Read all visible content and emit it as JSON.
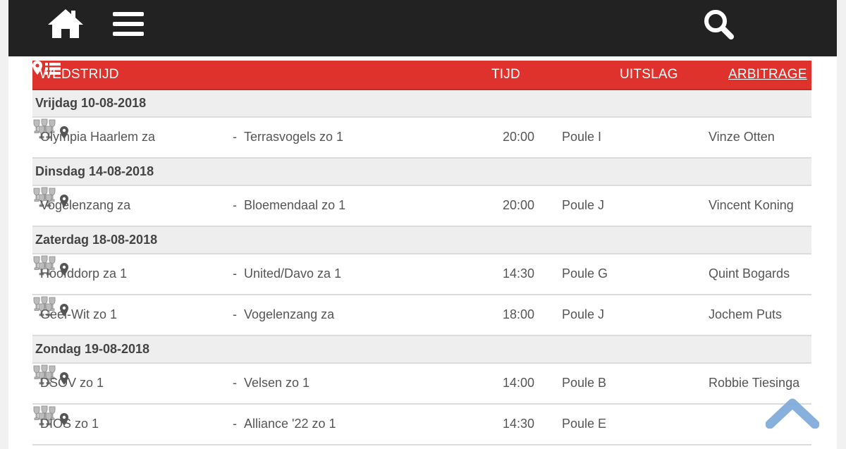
{
  "header": {
    "home_icon": "home-icon",
    "menu_icon": "hamburger-menu-icon",
    "search_icon": "search-icon",
    "background": "#222222"
  },
  "table": {
    "accent": "#e0322c",
    "columns": {
      "wedstrijd": "WEDSTRIJD",
      "tijd": "TIJD",
      "uitslag": "UITSLAG",
      "arbitrage": "ARBITRAGE"
    },
    "days": [
      {
        "date": "Vrijdag 10-08-2018",
        "matches": [
          {
            "home": "Olympia Haarlem za",
            "dash": "-",
            "away": "Terrasvogels zo 1",
            "time": "20:00",
            "poule": "Poule I",
            "referee": "Vinze  Otten"
          }
        ]
      },
      {
        "date": "Dinsdag 14-08-2018",
        "matches": [
          {
            "home": "Vogelenzang za",
            "dash": "-",
            "away": "Bloemendaal zo 1",
            "time": "20:00",
            "poule": "Poule J",
            "referee": "Vincent  Koning"
          }
        ]
      },
      {
        "date": "Zaterdag 18-08-2018",
        "matches": [
          {
            "home": "Hoofddorp za 1",
            "dash": "-",
            "away": "United/Davo za 1",
            "time": "14:30",
            "poule": "Poule G",
            "referee": "Quint  Bogards"
          },
          {
            "home": "Geel-Wit zo 1",
            "dash": "-",
            "away": "Vogelenzang za",
            "time": "18:00",
            "poule": "Poule J",
            "referee": "Jochem  Puts"
          }
        ]
      },
      {
        "date": "Zondag 19-08-2018",
        "matches": [
          {
            "home": "DSOV zo 1",
            "dash": "-",
            "away": "Velsen zo 1",
            "time": "14:00",
            "poule": "Poule B",
            "referee": "Robbie  Tiesinga"
          },
          {
            "home": "DIOS zo 1",
            "dash": "-",
            "away": "Alliance '22 zo 1",
            "time": "14:30",
            "poule": "Poule E",
            "referee": ""
          }
        ]
      }
    ]
  },
  "scroll_top_icon": "chevron-up-icon"
}
